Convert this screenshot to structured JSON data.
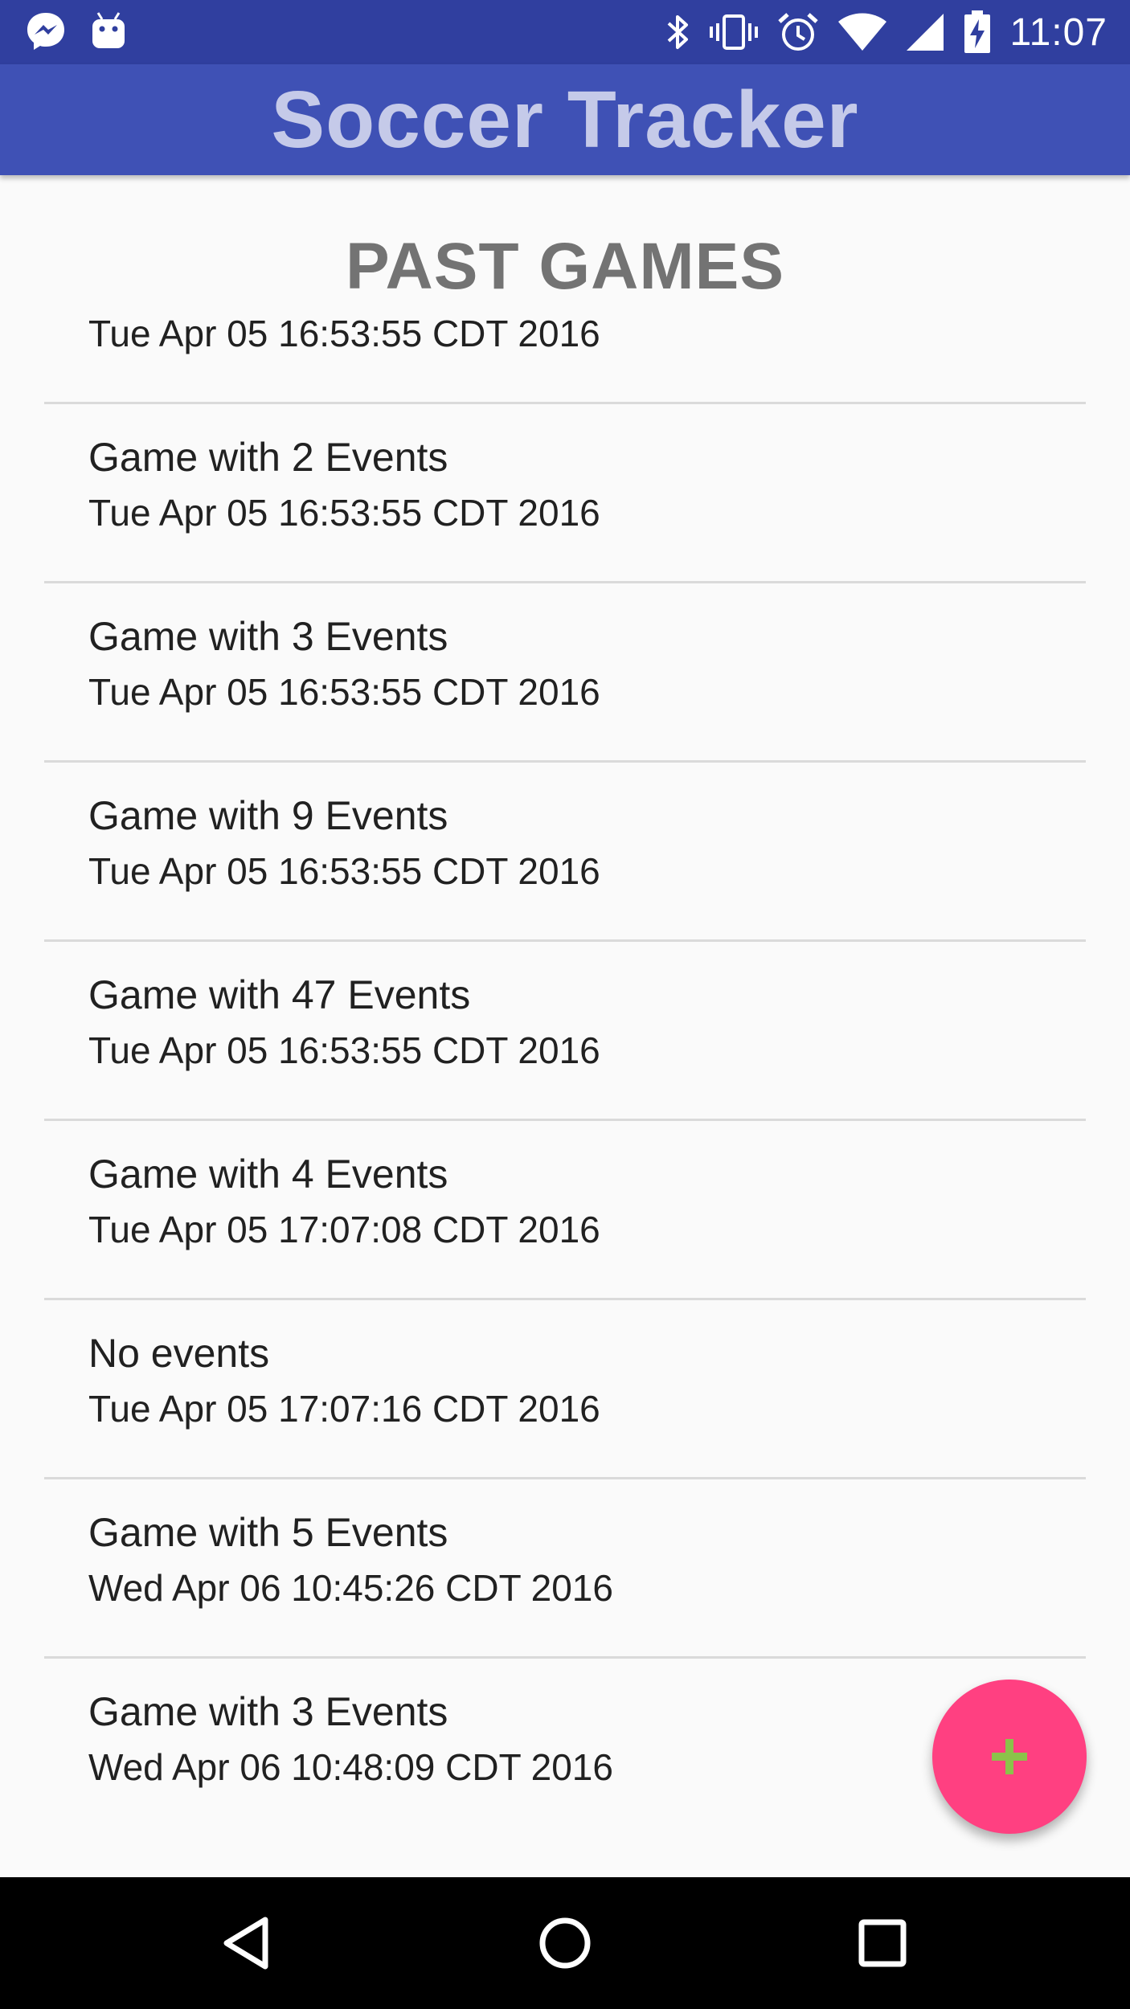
{
  "status_bar": {
    "time": "11:07",
    "left_icons": [
      "messenger-icon",
      "android-icon"
    ],
    "right_icons": [
      "bluetooth-icon",
      "vibrate-icon",
      "alarm-icon",
      "wifi-icon",
      "signal-icon",
      "battery-charging-icon"
    ]
  },
  "app_bar": {
    "title": "Soccer Tracker"
  },
  "section_title": "PAST GAMES",
  "games": [
    {
      "name": "",
      "date": "Tue Apr 05 16:53:55 CDT 2016"
    },
    {
      "name": "Game with 2 Events",
      "date": "Tue Apr 05 16:53:55 CDT 2016"
    },
    {
      "name": "Game with 3 Events",
      "date": "Tue Apr 05 16:53:55 CDT 2016"
    },
    {
      "name": "Game with 9 Events",
      "date": "Tue Apr 05 16:53:55 CDT 2016"
    },
    {
      "name": "Game with 47 Events",
      "date": "Tue Apr 05 16:53:55 CDT 2016"
    },
    {
      "name": "Game with 4 Events",
      "date": "Tue Apr 05 17:07:08 CDT 2016"
    },
    {
      "name": "No events",
      "date": "Tue Apr 05 17:07:16 CDT 2016"
    },
    {
      "name": "Game with 5 Events",
      "date": "Wed Apr 06 10:45:26 CDT 2016"
    },
    {
      "name": "Game with 3 Events",
      "date": "Wed Apr 06 10:48:09 CDT 2016"
    }
  ],
  "fab": {
    "icon": "plus-icon"
  },
  "nav_bar": {
    "buttons": [
      "back-icon",
      "home-icon",
      "recents-icon"
    ]
  },
  "colors": {
    "status_bar": "#303f9f",
    "app_bar": "#3f51b5",
    "title_text": "#c5cae9",
    "fab": "#ff4081",
    "fab_icon": "#8bc34a"
  }
}
